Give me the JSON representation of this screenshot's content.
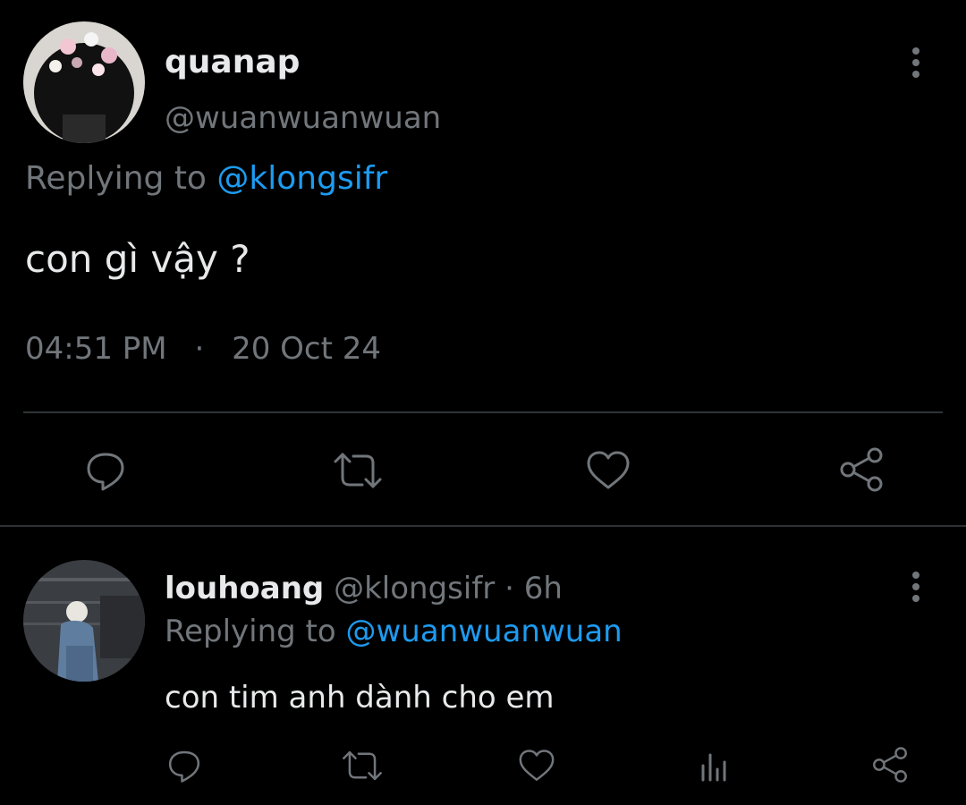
{
  "main_tweet": {
    "display_name": "quanap",
    "handle": "@wuanwuanwuan",
    "replying_label": "Replying to",
    "replying_to": "@klongsifr",
    "text": "con gì vậy ?",
    "time": "04:51 PM",
    "separator": "·",
    "date": "20 Oct 24",
    "actions": [
      "reply-icon",
      "retweet-icon",
      "like-icon",
      "share-icon"
    ]
  },
  "reply": {
    "display_name": "louhoang",
    "handle": "@klongsifr",
    "separator": "·",
    "age": "6h",
    "replying_label": "Replying to",
    "replying_to": "@wuanwuanwuan",
    "text": "con tim anh dành cho em",
    "actions": [
      "reply-icon",
      "retweet-icon",
      "like-icon",
      "analytics-icon",
      "share-icon"
    ]
  },
  "colors": {
    "background": "#000000",
    "text": "#e7e9ea",
    "muted": "#71767b",
    "accent": "#1d9bf0"
  }
}
